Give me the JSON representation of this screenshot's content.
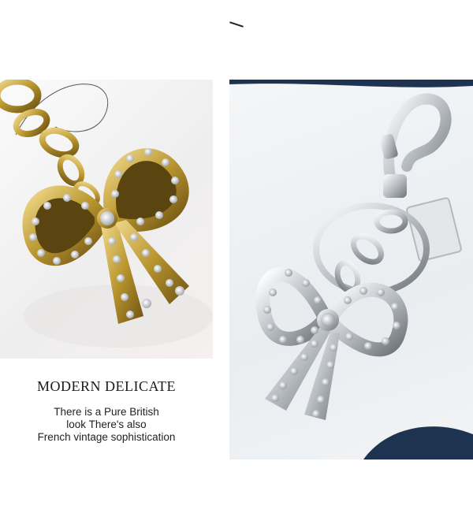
{
  "caption": {
    "heading": "MODERN DELICATE",
    "lines": [
      "There is a Pure British",
      "look There's also",
      "French vintage sophistication"
    ]
  },
  "images": {
    "left": {
      "subject": "gold-bow-keychain-photo",
      "accent": "#b8952e"
    },
    "right": {
      "subject": "silver-bow-keychain-photo",
      "accent": "#c9ccd1"
    }
  },
  "colors": {
    "background": "#ffffff",
    "dark_accent": "#1e3350"
  }
}
